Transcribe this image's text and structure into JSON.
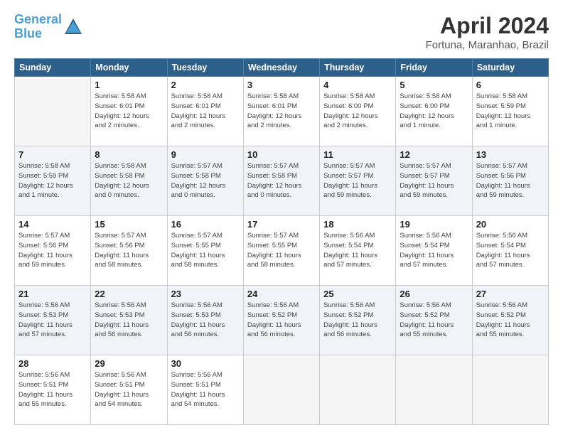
{
  "header": {
    "logo_line1": "General",
    "logo_line2": "Blue",
    "title": "April 2024",
    "subtitle": "Fortuna, Maranhao, Brazil"
  },
  "days_of_week": [
    "Sunday",
    "Monday",
    "Tuesday",
    "Wednesday",
    "Thursday",
    "Friday",
    "Saturday"
  ],
  "weeks": [
    [
      {
        "day": "",
        "info": ""
      },
      {
        "day": "1",
        "info": "Sunrise: 5:58 AM\nSunset: 6:01 PM\nDaylight: 12 hours\nand 2 minutes."
      },
      {
        "day": "2",
        "info": "Sunrise: 5:58 AM\nSunset: 6:01 PM\nDaylight: 12 hours\nand 2 minutes."
      },
      {
        "day": "3",
        "info": "Sunrise: 5:58 AM\nSunset: 6:01 PM\nDaylight: 12 hours\nand 2 minutes."
      },
      {
        "day": "4",
        "info": "Sunrise: 5:58 AM\nSunset: 6:00 PM\nDaylight: 12 hours\nand 2 minutes."
      },
      {
        "day": "5",
        "info": "Sunrise: 5:58 AM\nSunset: 6:00 PM\nDaylight: 12 hours\nand 1 minute."
      },
      {
        "day": "6",
        "info": "Sunrise: 5:58 AM\nSunset: 5:59 PM\nDaylight: 12 hours\nand 1 minute."
      }
    ],
    [
      {
        "day": "7",
        "info": "Sunrise: 5:58 AM\nSunset: 5:59 PM\nDaylight: 12 hours\nand 1 minute."
      },
      {
        "day": "8",
        "info": "Sunrise: 5:58 AM\nSunset: 5:58 PM\nDaylight: 12 hours\nand 0 minutes."
      },
      {
        "day": "9",
        "info": "Sunrise: 5:57 AM\nSunset: 5:58 PM\nDaylight: 12 hours\nand 0 minutes."
      },
      {
        "day": "10",
        "info": "Sunrise: 5:57 AM\nSunset: 5:58 PM\nDaylight: 12 hours\nand 0 minutes."
      },
      {
        "day": "11",
        "info": "Sunrise: 5:57 AM\nSunset: 5:57 PM\nDaylight: 11 hours\nand 59 minutes."
      },
      {
        "day": "12",
        "info": "Sunrise: 5:57 AM\nSunset: 5:57 PM\nDaylight: 11 hours\nand 59 minutes."
      },
      {
        "day": "13",
        "info": "Sunrise: 5:57 AM\nSunset: 5:56 PM\nDaylight: 11 hours\nand 59 minutes."
      }
    ],
    [
      {
        "day": "14",
        "info": "Sunrise: 5:57 AM\nSunset: 5:56 PM\nDaylight: 11 hours\nand 59 minutes."
      },
      {
        "day": "15",
        "info": "Sunrise: 5:57 AM\nSunset: 5:56 PM\nDaylight: 11 hours\nand 58 minutes."
      },
      {
        "day": "16",
        "info": "Sunrise: 5:57 AM\nSunset: 5:55 PM\nDaylight: 11 hours\nand 58 minutes."
      },
      {
        "day": "17",
        "info": "Sunrise: 5:57 AM\nSunset: 5:55 PM\nDaylight: 11 hours\nand 58 minutes."
      },
      {
        "day": "18",
        "info": "Sunrise: 5:56 AM\nSunset: 5:54 PM\nDaylight: 11 hours\nand 57 minutes."
      },
      {
        "day": "19",
        "info": "Sunrise: 5:56 AM\nSunset: 5:54 PM\nDaylight: 11 hours\nand 57 minutes."
      },
      {
        "day": "20",
        "info": "Sunrise: 5:56 AM\nSunset: 5:54 PM\nDaylight: 11 hours\nand 57 minutes."
      }
    ],
    [
      {
        "day": "21",
        "info": "Sunrise: 5:56 AM\nSunset: 5:53 PM\nDaylight: 11 hours\nand 57 minutes."
      },
      {
        "day": "22",
        "info": "Sunrise: 5:56 AM\nSunset: 5:53 PM\nDaylight: 11 hours\nand 56 minutes."
      },
      {
        "day": "23",
        "info": "Sunrise: 5:56 AM\nSunset: 5:53 PM\nDaylight: 11 hours\nand 56 minutes."
      },
      {
        "day": "24",
        "info": "Sunrise: 5:56 AM\nSunset: 5:52 PM\nDaylight: 11 hours\nand 56 minutes."
      },
      {
        "day": "25",
        "info": "Sunrise: 5:56 AM\nSunset: 5:52 PM\nDaylight: 11 hours\nand 56 minutes."
      },
      {
        "day": "26",
        "info": "Sunrise: 5:56 AM\nSunset: 5:52 PM\nDaylight: 11 hours\nand 55 minutes."
      },
      {
        "day": "27",
        "info": "Sunrise: 5:56 AM\nSunset: 5:52 PM\nDaylight: 11 hours\nand 55 minutes."
      }
    ],
    [
      {
        "day": "28",
        "info": "Sunrise: 5:56 AM\nSunset: 5:51 PM\nDaylight: 11 hours\nand 55 minutes."
      },
      {
        "day": "29",
        "info": "Sunrise: 5:56 AM\nSunset: 5:51 PM\nDaylight: 11 hours\nand 54 minutes."
      },
      {
        "day": "30",
        "info": "Sunrise: 5:56 AM\nSunset: 5:51 PM\nDaylight: 11 hours\nand 54 minutes."
      },
      {
        "day": "",
        "info": ""
      },
      {
        "day": "",
        "info": ""
      },
      {
        "day": "",
        "info": ""
      },
      {
        "day": "",
        "info": ""
      }
    ]
  ]
}
